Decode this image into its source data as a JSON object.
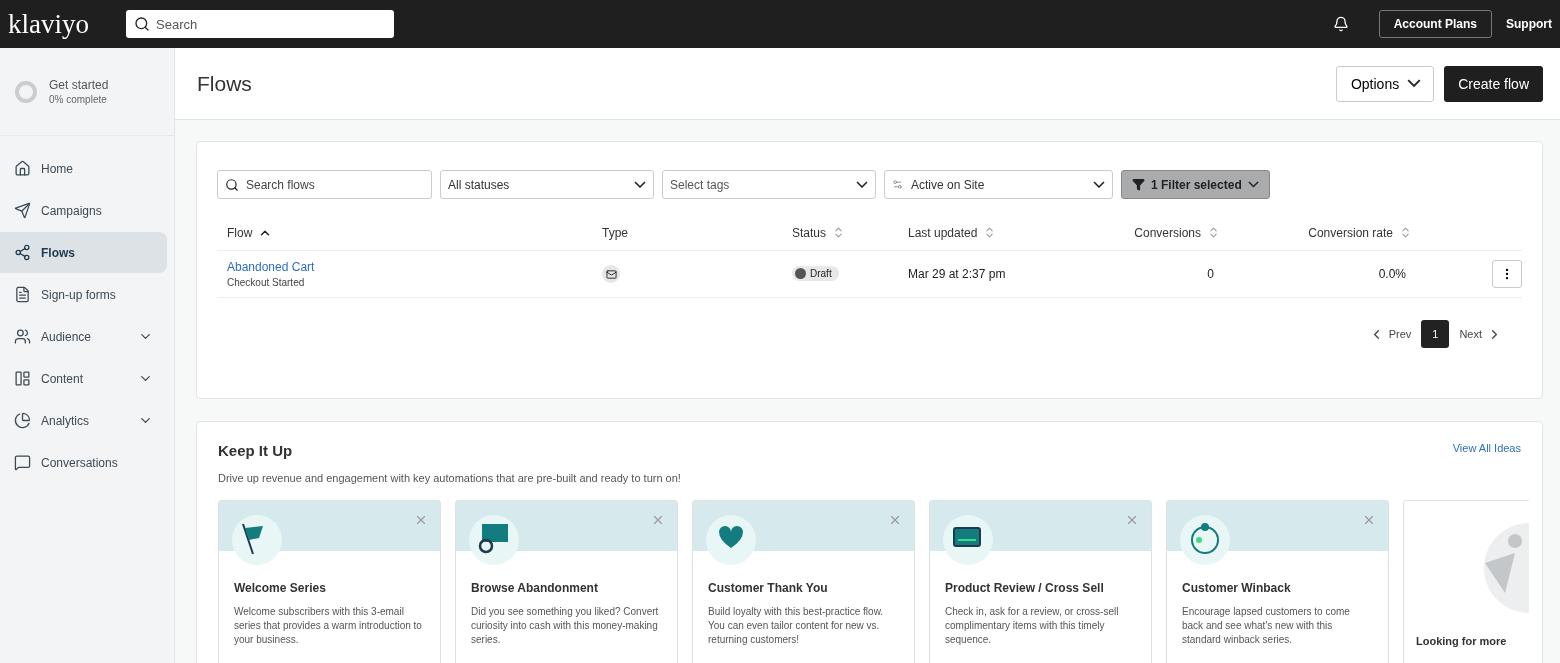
{
  "topbar": {
    "logo": "klaviyo",
    "search_placeholder": "Search",
    "account_button": "Account Plans",
    "support_link": "Support"
  },
  "sidebar": {
    "progress": {
      "title": "Get started",
      "subtitle": "0% complete"
    },
    "items": [
      {
        "label": "Home",
        "selected": false,
        "expandable": false
      },
      {
        "label": "Campaigns",
        "selected": false,
        "expandable": false
      },
      {
        "label": "Flows",
        "selected": true,
        "expandable": false
      },
      {
        "label": "Sign-up forms",
        "selected": false,
        "expandable": false
      },
      {
        "label": "Audience",
        "selected": false,
        "expandable": true
      },
      {
        "label": "Content",
        "selected": false,
        "expandable": true
      },
      {
        "label": "Analytics",
        "selected": false,
        "expandable": true
      },
      {
        "label": "Conversations",
        "selected": false,
        "expandable": false
      }
    ]
  },
  "header": {
    "title": "Flows",
    "options_button": "Options",
    "create_button": "Create flow"
  },
  "filters": {
    "search_placeholder": "Search flows",
    "status": "All statuses",
    "tags_placeholder": "Select tags",
    "site": "Active on Site",
    "filter_button": "1 Filter selected"
  },
  "table": {
    "columns": [
      {
        "label": "Flow",
        "sorted": true
      },
      {
        "label": "Type",
        "sortable": false
      },
      {
        "label": "Status",
        "sortable": true
      },
      {
        "label": "Last updated",
        "sortable": true
      },
      {
        "label": "Conversions",
        "sortable": true
      },
      {
        "label": "Conversion rate",
        "sortable": true
      }
    ],
    "rows": [
      {
        "name": "Abandoned Cart",
        "trigger": "Checkout Started",
        "status": "Draft",
        "last_updated": "Mar 29 at 2:37 pm",
        "conversions": "0",
        "conversion_rate": "0.0%"
      }
    ]
  },
  "pagination": {
    "prev": "Prev",
    "pages": [
      {
        "label": "1",
        "selected": true
      }
    ],
    "next": "Next"
  },
  "ideas": {
    "title": "Keep It Up",
    "subtitle": "Drive up revenue and engagement with key automations that are pre-built and ready to turn on!",
    "view_all": "View All Ideas",
    "cards": [
      {
        "kind": "idea",
        "title": "Welcome Series",
        "text": "Welcome subscribers with this 3-email series that provides a warm introduction to your business."
      },
      {
        "kind": "idea",
        "title": "Browse Abandonment",
        "text": "Did you see something you liked? Convert curiosity into cash with this money-making series."
      },
      {
        "kind": "idea",
        "title": "Customer Thank You",
        "text": "Build loyalty with this best-practice flow. You can even tailor content for new vs. returning customers!"
      },
      {
        "kind": "idea",
        "title": "Product Review / Cross Sell",
        "text": "Check in, ask for a review, or cross-sell complimentary items with this timely sequence."
      },
      {
        "kind": "idea",
        "title": "Customer Winback",
        "text": "Encourage lapsed customers to come back and see what's new with this standard winback series."
      },
      {
        "kind": "more",
        "title": "Looking for more"
      }
    ]
  }
}
